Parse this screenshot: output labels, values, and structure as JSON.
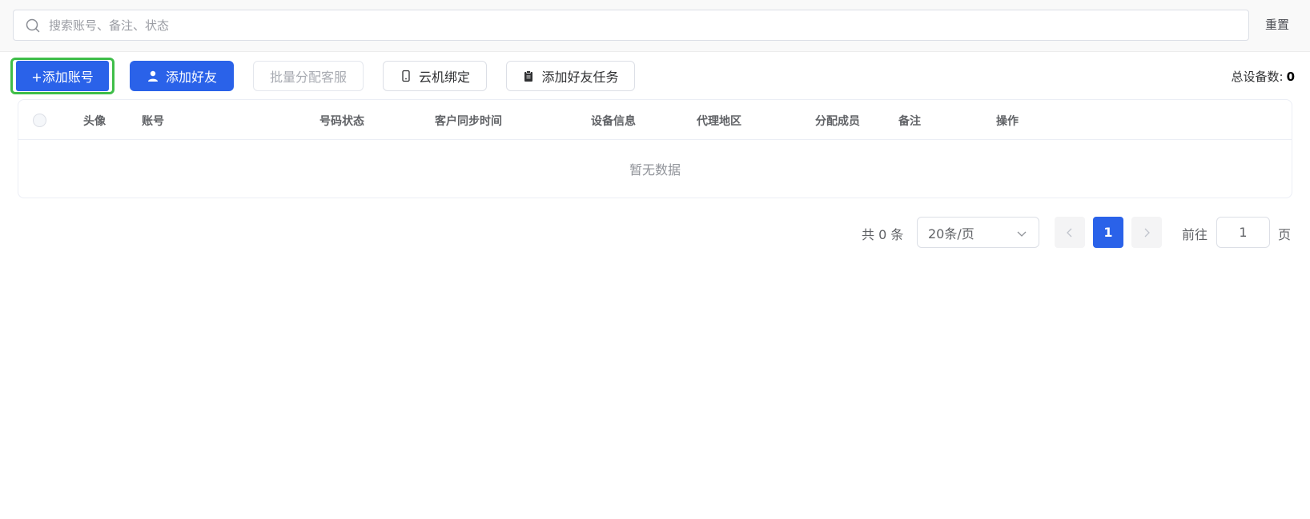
{
  "search": {
    "placeholder": "搜索账号、备注、状态",
    "value": ""
  },
  "toolbar": {
    "reset_label": "重置",
    "add_account_label": "+添加账号",
    "add_friend_label": "添加好友",
    "batch_assign_label": "批量分配客服",
    "cloud_bind_label": "云机绑定",
    "add_friend_task_label": "添加好友任务"
  },
  "total_devices": {
    "label": "总设备数:",
    "value": "0"
  },
  "table": {
    "columns": [
      "头像",
      "账号",
      "号码状态",
      "客户同步时间",
      "设备信息",
      "代理地区",
      "分配成员",
      "备注",
      "操作"
    ],
    "empty_text": "暂无数据"
  },
  "pagination": {
    "total_text": "共 0 条",
    "page_size": "20条/页",
    "current_page": "1",
    "goto_label": "前往",
    "goto_value": "1",
    "goto_unit": "页"
  },
  "colors": {
    "primary": "#2a62e9",
    "focus": "#3fbe49"
  }
}
